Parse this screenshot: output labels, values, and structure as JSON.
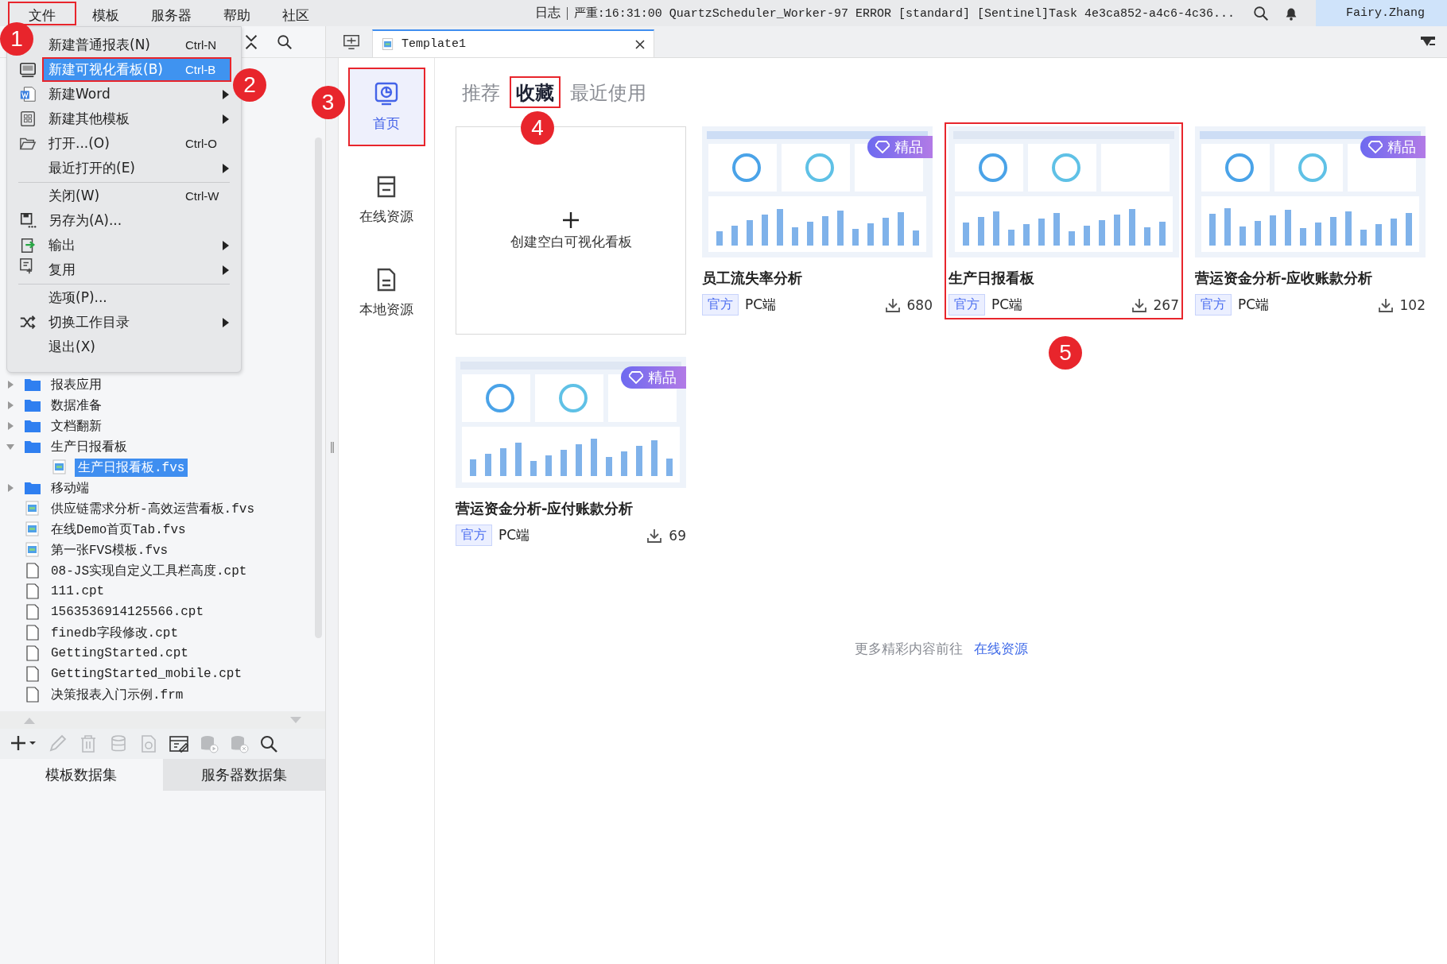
{
  "menubar": {
    "items": [
      {
        "label": "文件",
        "highlighted": true,
        "marker": "1"
      },
      {
        "label": "模板",
        "highlighted": false
      },
      {
        "label": "服务器",
        "highlighted": false
      },
      {
        "label": "帮助",
        "highlighted": false
      },
      {
        "label": "社区",
        "highlighted": false
      }
    ],
    "log": {
      "label": "日志",
      "message": "严重:16:31:00 QuartzScheduler_Worker-97 ERROR [standard] [Sentinel]Task 4e3ca852-a4c6-4c36..."
    },
    "user": "Fairy.Zhang"
  },
  "file_menu": {
    "items": [
      {
        "kind": "none",
        "label": "新建普通报表(N)",
        "shortcut": "Ctrl-N",
        "submenu": false,
        "selected": false,
        "highlighted": false,
        "separator_after": false
      },
      {
        "kind": "dashboard",
        "label": "新建可视化看板(B)",
        "shortcut": "Ctrl-B",
        "submenu": false,
        "selected": true,
        "highlighted": true,
        "marker": "2",
        "separator_after": false
      },
      {
        "kind": "word",
        "label": "新建Word",
        "submenu": true,
        "selected": false,
        "highlighted": false,
        "separator_after": false
      },
      {
        "kind": "grid",
        "label": "新建其他模板",
        "submenu": true,
        "selected": false,
        "highlighted": false,
        "separator_after": false
      },
      {
        "kind": "open",
        "label": "打开...(O)",
        "shortcut": "Ctrl-O",
        "submenu": false,
        "selected": false,
        "highlighted": false,
        "separator_after": false
      },
      {
        "kind": "none",
        "label": "最近打开的(E)",
        "submenu": true,
        "selected": false,
        "highlighted": false,
        "separator_after": true
      },
      {
        "kind": "none",
        "label": "关闭(W)",
        "shortcut": "Ctrl-W",
        "submenu": false,
        "selected": false,
        "highlighted": false,
        "separator_after": false
      },
      {
        "kind": "save",
        "label": "另存为(A)...",
        "submenu": false,
        "selected": false,
        "highlighted": false,
        "separator_after": false
      },
      {
        "kind": "export",
        "label": "输出",
        "submenu": true,
        "selected": false,
        "highlighted": false,
        "separator_after": false
      },
      {
        "kind": "reuse",
        "label": "复用",
        "submenu": true,
        "selected": false,
        "highlighted": false,
        "separator_after": true
      },
      {
        "kind": "none",
        "label": "选项(P)...",
        "submenu": false,
        "selected": false,
        "highlighted": false,
        "separator_after": false
      },
      {
        "kind": "shuffle",
        "label": "切换工作目录",
        "submenu": true,
        "selected": false,
        "highlighted": false,
        "separator_after": false
      },
      {
        "kind": "none",
        "label": "退出(X)",
        "submenu": false,
        "selected": false,
        "highlighted": false,
        "separator_after": false
      }
    ]
  },
  "tree": [
    {
      "kind": "folder",
      "label": "报表应用",
      "expanded": false,
      "selected": false
    },
    {
      "kind": "folder",
      "label": "数据准备",
      "expanded": false,
      "selected": false
    },
    {
      "kind": "folder",
      "label": "文档翻新",
      "expanded": false,
      "selected": false
    },
    {
      "kind": "folder",
      "label": "生产日报看板",
      "expanded": true,
      "selected": false,
      "children": [
        {
          "kind": "fvs",
          "label": "生产日报看板.fvs",
          "selected": true
        }
      ]
    },
    {
      "kind": "folder",
      "label": "移动端",
      "expanded": false,
      "selected": false
    },
    {
      "kind": "fvs",
      "label": "供应链需求分析-高效运营看板.fvs",
      "selected": false
    },
    {
      "kind": "fvs",
      "label": "在线Demo首页Tab.fvs",
      "selected": false
    },
    {
      "kind": "fvs",
      "label": "第一张FVS模板.fvs",
      "selected": false
    },
    {
      "kind": "cpt",
      "label": "08-JS实现自定义工具栏高度.cpt",
      "selected": false
    },
    {
      "kind": "cpt",
      "label": "111.cpt",
      "selected": false
    },
    {
      "kind": "cpt",
      "label": "1563536914125566.cpt",
      "selected": false
    },
    {
      "kind": "cpt",
      "label": "finedb字段修改.cpt",
      "selected": false
    },
    {
      "kind": "cpt",
      "label": "GettingStarted.cpt",
      "selected": false
    },
    {
      "kind": "cpt",
      "label": "GettingStarted_mobile.cpt",
      "selected": false
    },
    {
      "kind": "cpt",
      "label": "决策报表入门示例.frm",
      "selected": false
    }
  ],
  "toolbar": [
    {
      "kind": "add",
      "disabled": false
    },
    {
      "kind": "edit",
      "disabled": true
    },
    {
      "kind": "delete",
      "disabled": true
    },
    {
      "kind": "database",
      "disabled": true
    },
    {
      "kind": "preview",
      "disabled": true
    },
    {
      "kind": "dataset-edit",
      "disabled": false
    },
    {
      "kind": "db-play",
      "disabled": true
    },
    {
      "kind": "db-remove",
      "disabled": true
    },
    {
      "kind": "search",
      "disabled": false
    }
  ],
  "dataset_tabs": [
    {
      "label": "模板数据集",
      "selected": true
    },
    {
      "label": "服务器数据集",
      "selected": false
    }
  ],
  "editor_tabs": [
    {
      "label": "Template1",
      "selected": true
    }
  ],
  "nav": [
    {
      "kind": "home",
      "label": "首页",
      "selected": true,
      "highlighted": true,
      "marker": "3"
    },
    {
      "kind": "online",
      "label": "在线资源",
      "selected": false,
      "highlighted": false
    },
    {
      "kind": "local",
      "label": "本地资源",
      "selected": false,
      "highlighted": false
    }
  ],
  "content_tabs": [
    {
      "label": "推荐",
      "selected": false,
      "highlighted": false
    },
    {
      "label": "收藏",
      "selected": true,
      "highlighted": true,
      "marker": "4"
    },
    {
      "label": "最近使用",
      "selected": false,
      "highlighted": false
    }
  ],
  "create_card": {
    "label": "创建空白可视化看板"
  },
  "templates": [
    {
      "title": "员工流失率分析",
      "badge": "精品",
      "tag": "官方",
      "platform": "PC端",
      "downloads": "680",
      "highlighted": false
    },
    {
      "title": "生产日报看板",
      "tag": "官方",
      "platform": "PC端",
      "downloads": "267",
      "highlighted": true,
      "marker": "5"
    },
    {
      "title": "营运资金分析-应收账款分析",
      "badge": "精品",
      "tag": "官方",
      "platform": "PC端",
      "downloads": "102",
      "highlighted": false
    },
    {
      "title": "营运资金分析-应付账款分析",
      "badge": "精品",
      "tag": "官方",
      "platform": "PC端",
      "downloads": "69",
      "highlighted": false
    }
  ],
  "footer": {
    "text": "更多精彩内容前往",
    "link": "在线资源"
  }
}
